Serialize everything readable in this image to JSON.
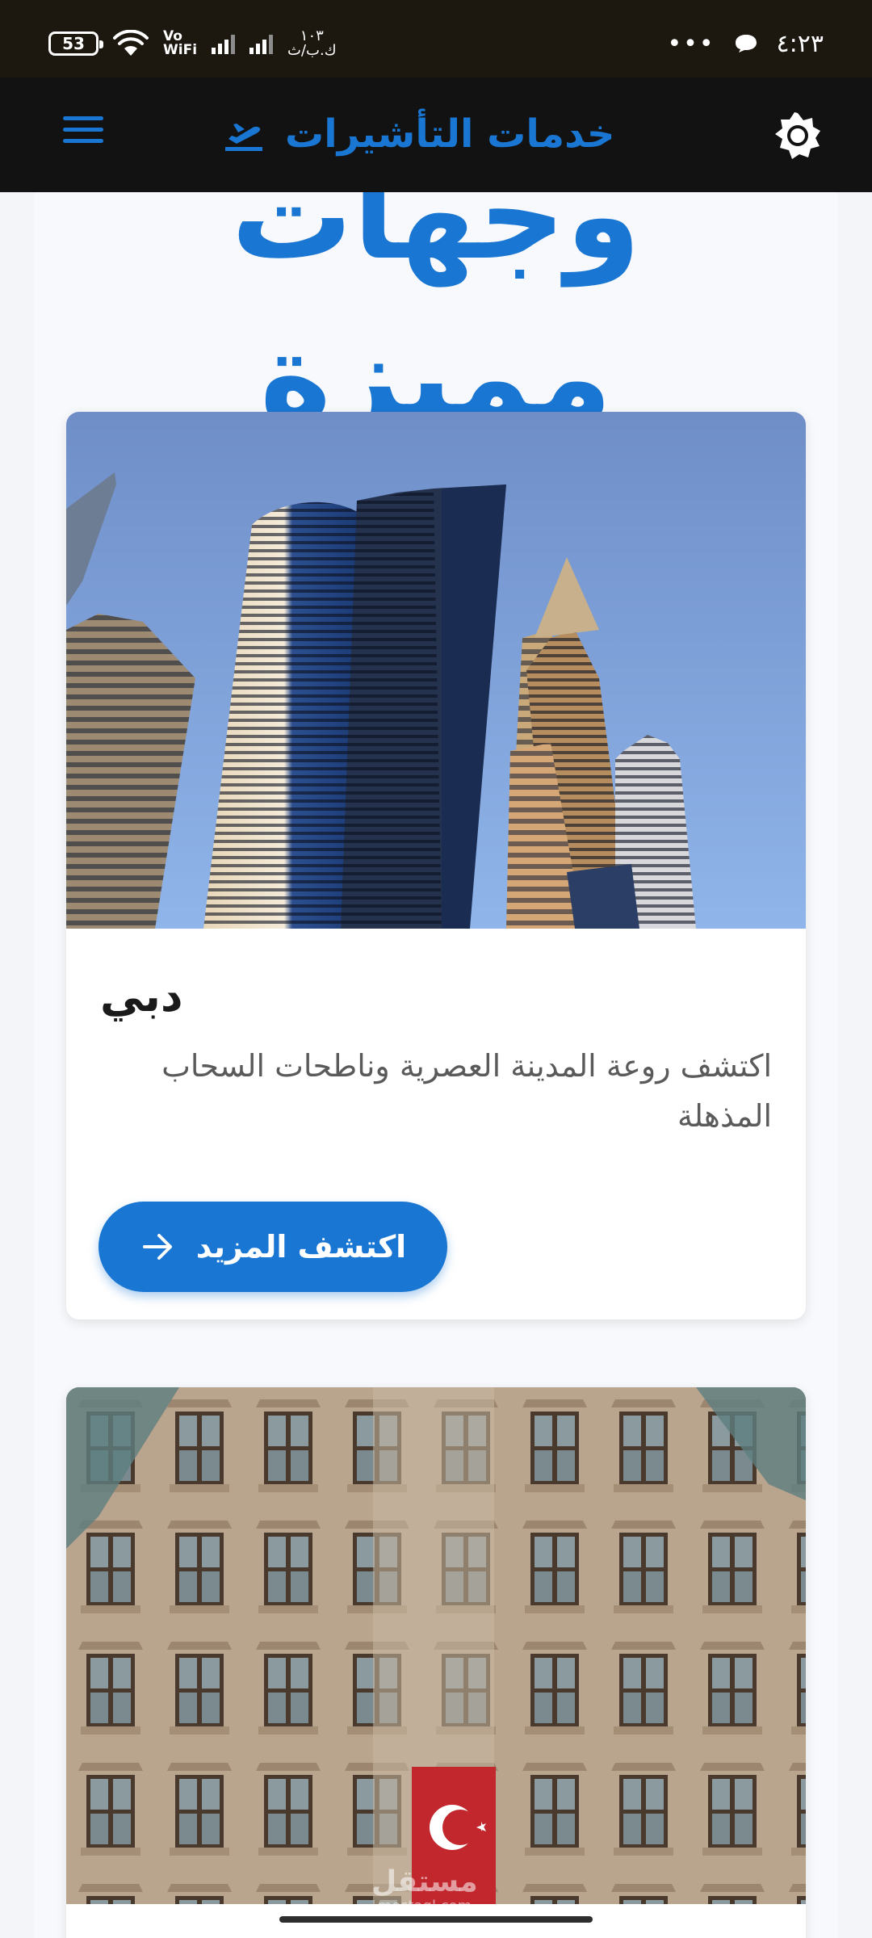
{
  "status_bar": {
    "battery": "53",
    "vowifi_top": "Vo",
    "vowifi_bottom": "WiFi",
    "speed_top": "١٠٣",
    "speed_bottom": "ك.ب/ث",
    "time": "٤:٢٣",
    "more": "•••"
  },
  "app_bar": {
    "title": "خدمات التأشيرات",
    "menu_icon": "menu-icon",
    "logo_icon": "plane-takeoff-icon",
    "theme_icon": "brightness-icon",
    "accent_color": "#1976d2"
  },
  "section": {
    "heading": "وجهات مميزة"
  },
  "destinations": [
    {
      "title": "دبي",
      "description": "اكتشف روعة المدينة العصرية وناطحات السحاب المذهلة",
      "cta": "اكتشف المزيد",
      "cta_icon": "arrow-right-icon",
      "image": "dubai-skyscrapers-photo"
    },
    {
      "title": "",
      "image": "istanbul-building-flag-photo"
    }
  ],
  "watermark": {
    "main": "مستقل",
    "sub": "mostaql.com"
  }
}
